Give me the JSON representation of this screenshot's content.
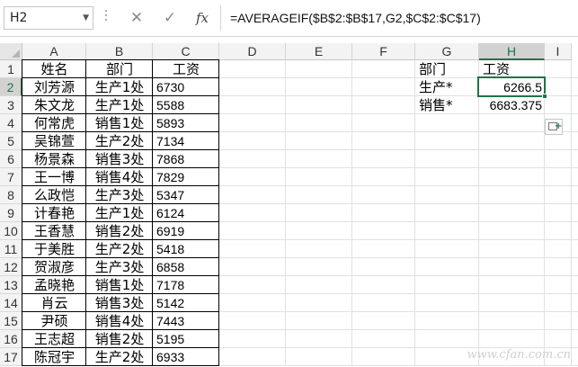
{
  "formula_bar": {
    "name_box": "H2",
    "cancel_glyph": "✕",
    "enter_glyph": "✓",
    "fx_glyph": "fx",
    "formula": "=AVERAGEIF($B$2:$B$17,G2,$C$2:$C$17)"
  },
  "columns": [
    "A",
    "B",
    "C",
    "D",
    "E",
    "F",
    "G",
    "H",
    "I"
  ],
  "selected_column": "H",
  "selected_row": "2",
  "rows": [
    "1",
    "2",
    "3",
    "4",
    "5",
    "6",
    "7",
    "8",
    "9",
    "10",
    "11",
    "12",
    "13",
    "14",
    "15",
    "16",
    "17"
  ],
  "table": {
    "headers": [
      "姓名",
      "部门",
      "工资"
    ],
    "records": [
      [
        "刘芳源",
        "生产1处",
        "6730"
      ],
      [
        "朱文龙",
        "生产1处",
        "5588"
      ],
      [
        "何常虎",
        "销售1处",
        "5893"
      ],
      [
        "吴锦萱",
        "生产2处",
        "7134"
      ],
      [
        "杨景森",
        "销售3处",
        "7868"
      ],
      [
        "王一博",
        "销售4处",
        "7829"
      ],
      [
        "么政恺",
        "生产3处",
        "5347"
      ],
      [
        "计春艳",
        "生产1处",
        "6124"
      ],
      [
        "王香慧",
        "销售2处",
        "6919"
      ],
      [
        "于美胜",
        "生产2处",
        "5418"
      ],
      [
        "贺淑彦",
        "生产3处",
        "6858"
      ],
      [
        "孟晓艳",
        "销售1处",
        "7178"
      ],
      [
        "肖云",
        "销售3处",
        "5142"
      ],
      [
        "尹硕",
        "销售4处",
        "7443"
      ],
      [
        "王志超",
        "销售2处",
        "5195"
      ],
      [
        "陈冠宇",
        "生产2处",
        "6933"
      ]
    ]
  },
  "summary": {
    "header_dept": "部门",
    "header_salary": "工资",
    "rows": [
      {
        "dept": "生产*",
        "avg": "6266.5"
      },
      {
        "dept": "销售*",
        "avg": "6683.375"
      }
    ]
  },
  "watermark": "www.cfan.com.cn"
}
